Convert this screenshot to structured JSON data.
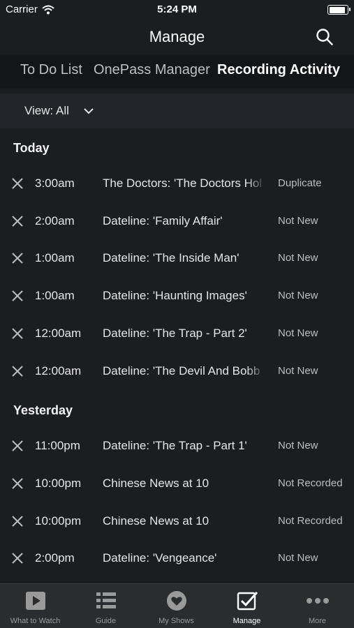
{
  "status_bar": {
    "carrier": "Carrier",
    "time": "5:24 PM"
  },
  "nav": {
    "title": "Manage"
  },
  "segments": [
    {
      "label": "To Do List",
      "active": false
    },
    {
      "label": "OnePass Manager",
      "active": false
    },
    {
      "label": "Recording Activity",
      "active": true
    }
  ],
  "view": {
    "label": "View: All"
  },
  "sections": [
    {
      "header": "Today",
      "rows": [
        {
          "time": "3:00am",
          "title": "The Doctors: 'The Doctors Hol",
          "status": "Duplicate"
        },
        {
          "time": "2:00am",
          "title": "Dateline: 'Family Affair'",
          "status": "Not New"
        },
        {
          "time": "1:00am",
          "title": "Dateline: 'The Inside Man'",
          "status": "Not New"
        },
        {
          "time": "1:00am",
          "title": "Dateline: 'Haunting Images'",
          "status": "Not New"
        },
        {
          "time": "12:00am",
          "title": "Dateline: 'The Trap - Part 2'",
          "status": "Not New"
        },
        {
          "time": "12:00am",
          "title": "Dateline: 'The Devil And Bobb",
          "status": "Not New"
        }
      ]
    },
    {
      "header": "Yesterday",
      "rows": [
        {
          "time": "11:00pm",
          "title": "Dateline: 'The Trap - Part 1'",
          "status": "Not New"
        },
        {
          "time": "10:00pm",
          "title": "Chinese News at 10",
          "status": "Not Recorded"
        },
        {
          "time": "10:00pm",
          "title": "Chinese News at 10",
          "status": "Not Recorded"
        },
        {
          "time": "2:00pm",
          "title": "Dateline: 'Vengeance'",
          "status": "Not New"
        }
      ]
    }
  ],
  "tabs": [
    {
      "label": "What to Watch",
      "icon": "play-icon",
      "active": false
    },
    {
      "label": "Guide",
      "icon": "guide-list-icon",
      "active": false
    },
    {
      "label": "My Shows",
      "icon": "heart-icon",
      "active": false
    },
    {
      "label": "Manage",
      "icon": "checkbox-icon",
      "active": true
    },
    {
      "label": "More",
      "icon": "more-dots-icon",
      "active": false
    }
  ]
}
